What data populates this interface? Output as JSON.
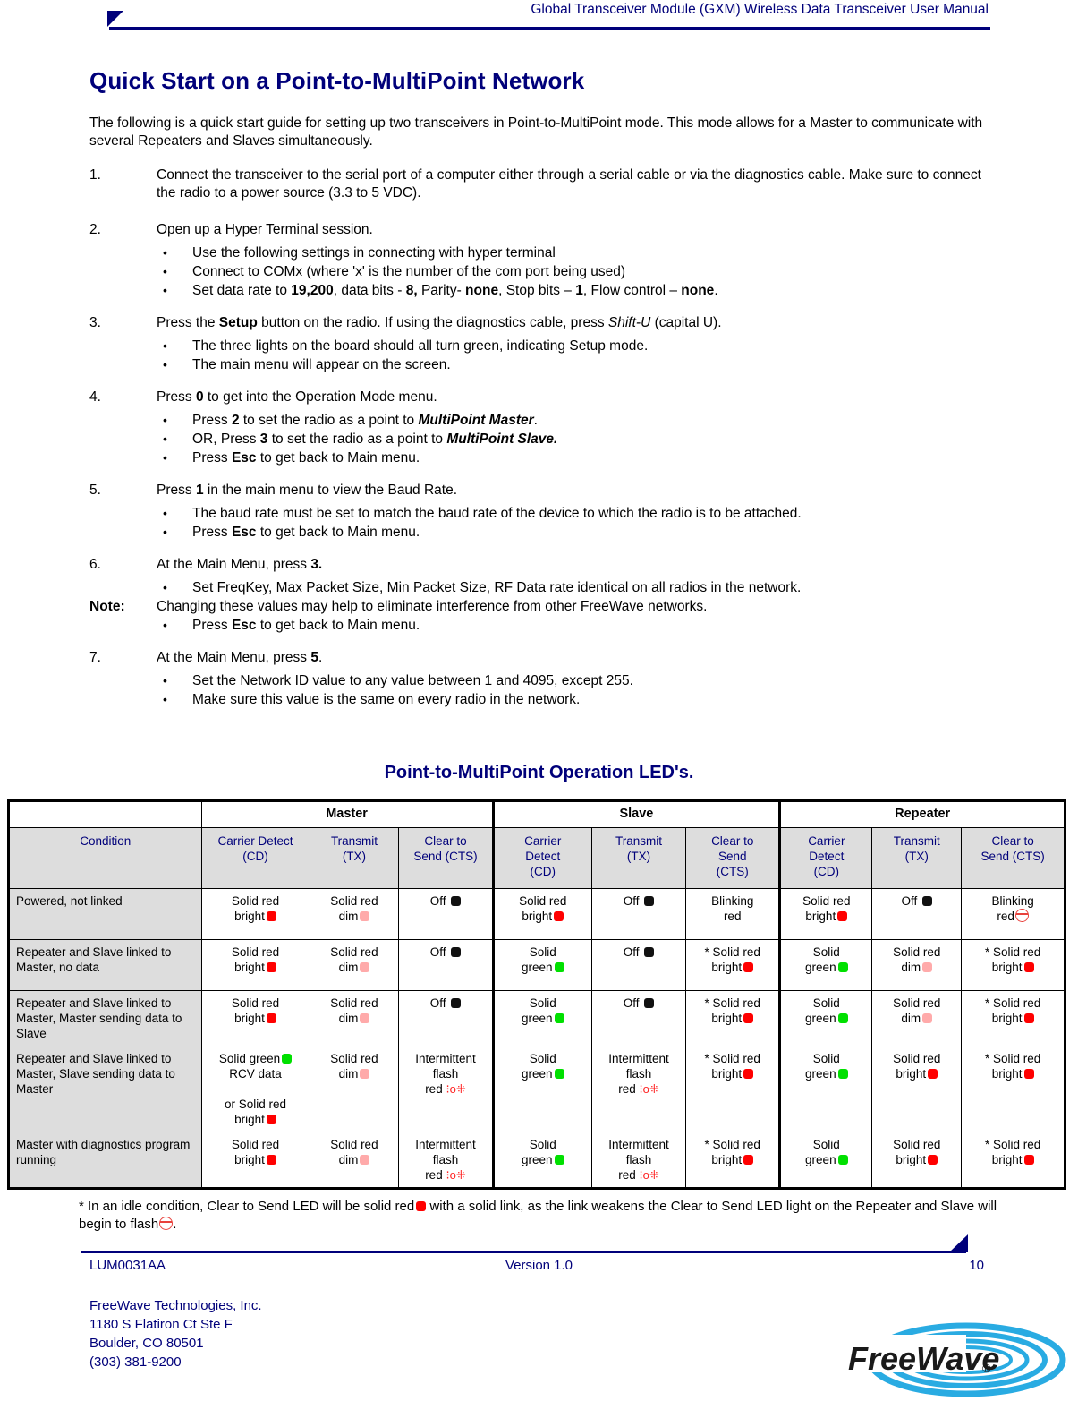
{
  "header": {
    "title": "Global Transceiver Module (GXM) Wireless Data Transceiver User Manual"
  },
  "headings": {
    "h1": "Quick Start on a Point-to-MultiPoint Network",
    "h2": "Point-to-MultiPoint Operation LED's."
  },
  "intro": "The following is a quick start guide for setting up two transceivers in Point-to-MultiPoint mode.  This mode allows for a Master to communicate with several Repeaters and Slaves simultaneously.",
  "steps": {
    "s1_num": "1.",
    "s1_text": "Connect the transceiver to the serial port of a computer either through a serial cable or via the diagnostics cable. Make sure to connect the radio to a power source (3.3 to 5 VDC).",
    "s2_num": "2.",
    "s2_text": "Open up a Hyper Terminal session.",
    "s2_b1": "Use the following settings in connecting with hyper terminal",
    "s2_b2": "Connect to COMx (where 'x' is the number of the com port being used)",
    "s2_b3_a": "Set data rate to ",
    "s2_b3_v1": "19,200",
    "s2_b3_b": ", data bits - ",
    "s2_b3_v2": "8,",
    "s2_b3_c": " Parity- ",
    "s2_b3_v3": "none",
    "s2_b3_d": ", Stop bits – ",
    "s2_b3_v4": "1",
    "s2_b3_e": ", Flow control – ",
    "s2_b3_v5": "none",
    "s2_b3_f": ".",
    "s3_num": "3.",
    "s3_a": "Press the ",
    "s3_v1": "Setup",
    "s3_b": " button on the radio.  If using the diagnostics cable, press ",
    "s3_v2": "Shift-U",
    "s3_c": " (capital U).",
    "s3_b1": "The three lights on the board should all turn green, indicating Setup mode.",
    "s3_b2": "The main menu will appear on the screen.",
    "s4_num": "4.",
    "s4_a": "Press ",
    "s4_v1": "0",
    "s4_b": " to get into the Operation Mode menu.",
    "s4_b1_a": "Press ",
    "s4_b1_v": "2",
    "s4_b1_b": " to set the radio as a point to ",
    "s4_b1_v2": "MultiPoint Master",
    "s4_b1_c": ".",
    "s4_b2_a": "OR, Press ",
    "s4_b2_v": "3",
    "s4_b2_b": " to set the radio as a point to ",
    "s4_b2_v2": "MultiPoint Slave.",
    "s4_b3_a": "Press ",
    "s4_b3_v": "Esc",
    "s4_b3_b": " to get back to Main menu.",
    "s5_num": "5.",
    "s5_a": "Press ",
    "s5_v1": "1",
    "s5_b": " in the main menu to view the Baud Rate.",
    "s5_b1": "The baud rate must be set to match the baud rate of the device to which the radio is to be attached.",
    "s6_num": "6.",
    "s6_a": "At the Main Menu, press ",
    "s6_v1": "3.",
    "s6_b1": "Set FreqKey, Max Packet Size, Min Packet Size, RF Data rate identical on all radios in the network.",
    "note_label": "Note:",
    "note_text": "Changing these values may help to eliminate interference from other FreeWave networks.",
    "s7_num": "7.",
    "s7_a": "At the Main Menu, press ",
    "s7_v1": "5",
    "s7_b": ".",
    "s7_b1": "Set the Network ID value to any value between 1 and 4095, except 255.",
    "s7_b2": "Make sure this value is the same on every radio in the network."
  },
  "table": {
    "groups": [
      "Master",
      "Slave",
      "Repeater"
    ],
    "col_condition": "Condition",
    "headers": [
      "Carrier Detect (CD)",
      "Transmit (TX)",
      "Clear to Send (CTS)",
      "Carrier Detect (CD)",
      "Transmit (TX)",
      "Clear to Send (CTS)",
      "Carrier Detect (CD)",
      "Transmit (TX)",
      "Clear to Send  (CTS)"
    ],
    "hdr_m_cd_1": "Carrier Detect",
    "hdr_m_cd_2": "(CD)",
    "hdr_m_tx_1": "Transmit",
    "hdr_m_tx_2": "(TX)",
    "hdr_m_cts_1": "Clear to",
    "hdr_m_cts_2": "Send (CTS)",
    "hdr_s_cd_1": "Carrier",
    "hdr_s_cd_2": "Detect",
    "hdr_s_cd_3": "(CD)",
    "hdr_s_tx_1": "Transmit",
    "hdr_s_tx_2": "(TX)",
    "hdr_s_cts_1": "Clear to",
    "hdr_s_cts_2": "Send",
    "hdr_s_cts_3": "(CTS)",
    "hdr_r_cd_1": "Carrier",
    "hdr_r_cd_2": "Detect",
    "hdr_r_cd_3": "(CD)",
    "hdr_r_tx_1": "Transmit",
    "hdr_r_tx_2": "(TX)",
    "hdr_r_cts_1": "Clear to",
    "hdr_r_cts_2": "Send  (CTS)",
    "rows": [
      {
        "condition": "Powered, not linked",
        "m_cd_1": "Solid red",
        "m_cd_2": "bright",
        "m_cd_led": "red",
        "m_tx_1": "Solid red",
        "m_tx_2": "dim",
        "m_tx_led": "dim",
        "m_cts_1": "Off",
        "m_cts_led": "off",
        "s_cd_1": "Solid red",
        "s_cd_2": "bright",
        "s_cd_led": "red",
        "s_tx_1": "Off",
        "s_tx_led": "off",
        "s_cts_1": "Blinking",
        "s_cts_2": "red",
        "s_cts_led": "none",
        "r_cd_1": "Solid red",
        "r_cd_2": "bright",
        "r_cd_led": "red",
        "r_tx_1": "Off",
        "r_tx_led": "off",
        "r_cts_1": "Blinking",
        "r_cts_2": "red",
        "r_cts_led": "blink"
      },
      {
        "condition": "Repeater and Slave linked to Master, no data",
        "m_cd_1": "Solid red",
        "m_cd_2": "bright",
        "m_cd_led": "red",
        "m_tx_1": "Solid red",
        "m_tx_2": "dim",
        "m_tx_led": "dim",
        "m_cts_1": "Off",
        "m_cts_led": "off",
        "s_cd_1": "Solid",
        "s_cd_2": "green",
        "s_cd_led": "green",
        "s_tx_1": "Off",
        "s_tx_led": "off",
        "s_cts_1": "* Solid red",
        "s_cts_2": "bright",
        "s_cts_led": "red",
        "r_cd_1": "Solid",
        "r_cd_2": "green",
        "r_cd_led": "green",
        "r_tx_1": "Solid red",
        "r_tx_2": "dim",
        "r_tx_led": "dim",
        "r_cts_1": "* Solid red",
        "r_cts_2": "bright",
        "r_cts_led": "red"
      },
      {
        "condition": "Repeater and Slave linked to Master, Master sending data to Slave",
        "m_cd_1": "Solid red",
        "m_cd_2": "bright",
        "m_cd_led": "red",
        "m_tx_1": "Solid red",
        "m_tx_2": "dim",
        "m_tx_led": "dim",
        "m_cts_1": "Off",
        "m_cts_led": "off",
        "s_cd_1": "Solid",
        "s_cd_2": "green",
        "s_cd_led": "green",
        "s_tx_1": "Off",
        "s_tx_led": "off",
        "s_cts_1": "* Solid red",
        "s_cts_2": "bright",
        "s_cts_led": "red",
        "r_cd_1": "Solid",
        "r_cd_2": "green",
        "r_cd_led": "green",
        "r_tx_1": "Solid red",
        "r_tx_2": "dim",
        "r_tx_led": "dim",
        "r_cts_1": "* Solid red",
        "r_cts_2": "bright",
        "r_cts_led": "red"
      },
      {
        "condition": "Repeater and Slave linked to Master, Slave sending data to Master",
        "m_cd_1": "Solid green",
        "m_cd_led_first": "green",
        "m_cd_2": "RCV data",
        "m_cd_3": "or Solid red",
        "m_cd_4": "bright",
        "m_cd_led": "red",
        "m_tx_1": "Solid red",
        "m_tx_2": "dim",
        "m_tx_led": "dim",
        "m_cts_1": "Intermittent",
        "m_cts_2": "flash",
        "m_cts_3": "red",
        "m_cts_led": "flash",
        "s_cd_1": "Solid",
        "s_cd_2": "green",
        "s_cd_led": "green",
        "s_tx_1": "Intermittent",
        "s_tx_2": "flash",
        "s_tx_3": "red",
        "s_tx_led": "flash",
        "s_cts_1": "* Solid red",
        "s_cts_2": "bright",
        "s_cts_led": "red",
        "r_cd_1": "Solid",
        "r_cd_2": "green",
        "r_cd_led": "green",
        "r_tx_1": "Solid red",
        "r_tx_2": "bright",
        "r_tx_led": "red",
        "r_cts_1": "* Solid red",
        "r_cts_2": "bright",
        "r_cts_led": "red"
      },
      {
        "condition": "Master with diagnostics program running",
        "m_cd_1": "Solid red",
        "m_cd_2": "bright",
        "m_cd_led": "red",
        "m_tx_1": "Solid red",
        "m_tx_2": "dim",
        "m_tx_led": "dim",
        "m_cts_1": "Intermittent",
        "m_cts_2": "flash",
        "m_cts_3": "red",
        "m_cts_led": "flash",
        "s_cd_1": "Solid",
        "s_cd_2": "green",
        "s_cd_led": "green",
        "s_tx_1": "Intermittent",
        "s_tx_2": "flash",
        "s_tx_3": "red",
        "s_tx_led": "flash",
        "s_cts_1": "* Solid red",
        "s_cts_2": "bright",
        "s_cts_led": "red",
        "r_cd_1": "Solid",
        "r_cd_2": "green",
        "r_cd_led": "green",
        "r_tx_1": "Solid red",
        "r_tx_2": "bright",
        "r_tx_led": "red",
        "r_cts_1": "* Solid red",
        "r_cts_2": "bright",
        "r_cts_led": "red"
      }
    ]
  },
  "footnote": {
    "part1": "* In an idle condition, Clear to Send LED will be solid red",
    "part2": " with a solid link, as the link weakens the Clear to Send LED light on the Repeater and Slave will begin to flash",
    "part3": "."
  },
  "footer": {
    "doc_id": "LUM0031AA",
    "version": "Version 1.0",
    "page": "10",
    "company": "FreeWave Technologies, Inc.",
    "address1": "1180 S Flatiron Ct Ste F",
    "address2": "Boulder, CO 80501",
    "phone": "(303) 381-9200",
    "logo_text": "FreeWave",
    "logo_mark": "®"
  },
  "colors": {
    "navy": "#00007a",
    "led_red": "#ff0000",
    "led_dim": "#ffaaaa",
    "led_green": "#00e000",
    "led_off": "#111111",
    "blink_red": "#e8413c",
    "header_bg": "#dddddd",
    "logo_cyan": "#29abe2"
  }
}
